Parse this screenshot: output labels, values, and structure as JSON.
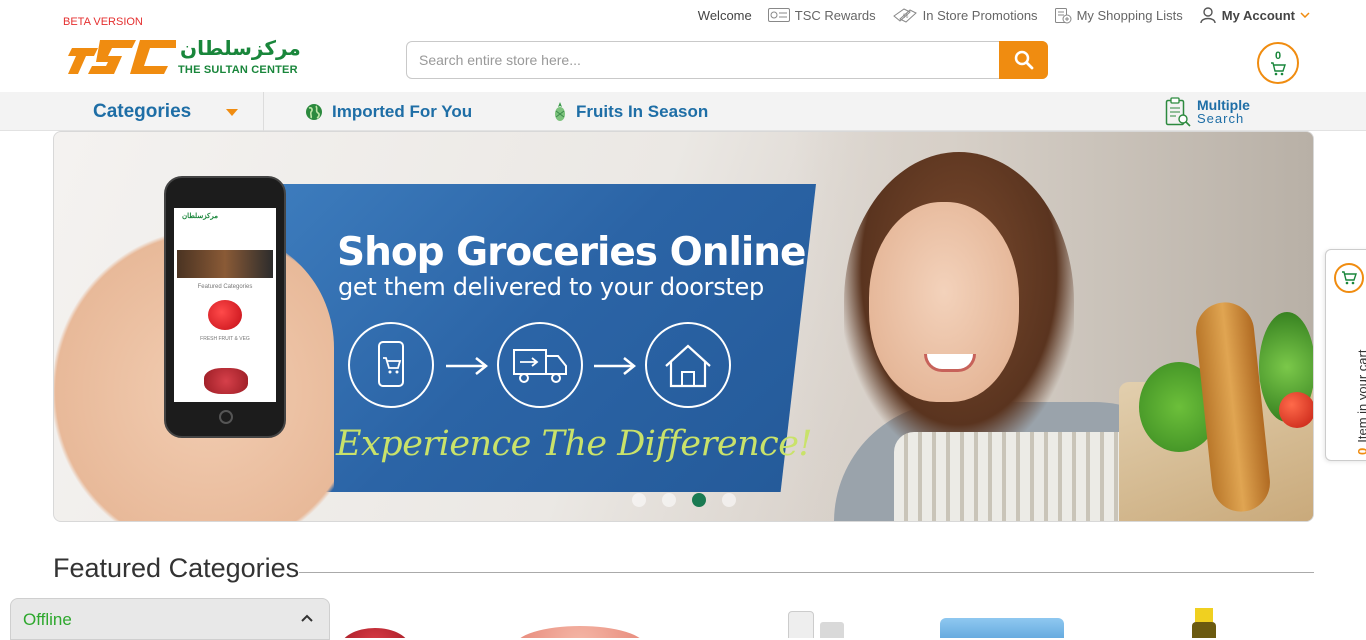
{
  "header": {
    "beta_label": "BETA VERSION",
    "logo_arabic": "مركزسلطان",
    "logo_english": "THE SULTAN CENTER",
    "top_links": {
      "welcome": "Welcome",
      "rewards": "TSC Rewards",
      "promotions": "In Store Promotions",
      "shopping_lists": "My Shopping Lists",
      "account": "My Account"
    },
    "search": {
      "placeholder": "Search entire store here..."
    },
    "cart_count": "0"
  },
  "nav": {
    "categories": "Categories",
    "imported": "Imported For You",
    "fruits": "Fruits In Season",
    "multiple_line1": "Multiple",
    "multiple_line2": "Search"
  },
  "banner": {
    "title": "Shop Groceries Online",
    "subtitle": "get them delivered to your doorstep",
    "tagline": "Experience The Difference!",
    "phone_screen": {
      "logo": "مركزسلطان",
      "section": "Featured Categories",
      "item": "FRESH FRUIT & VEG"
    },
    "slides": 4,
    "active_slide": 3
  },
  "side_cart": {
    "count": "0",
    "label": "Item in your cart"
  },
  "featured": {
    "title": "Featured Categories"
  },
  "offline": {
    "label": "Offline"
  },
  "colors": {
    "brand_orange": "#f08c10",
    "brand_green": "#19863b",
    "nav_blue": "#1e6ea6",
    "banner_blue": "#2b64a6"
  }
}
